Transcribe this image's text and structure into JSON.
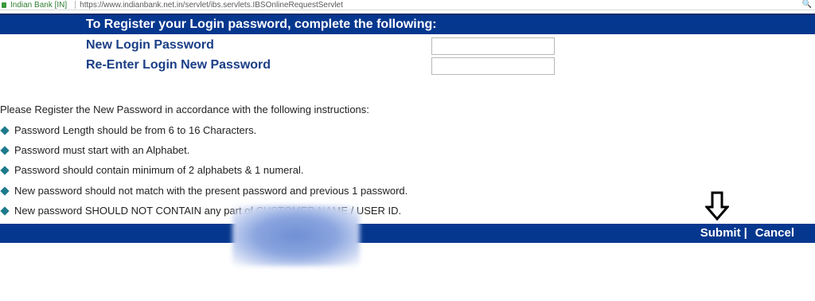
{
  "browser": {
    "site_name": "Indian Bank [IN]",
    "url": "https://www.indianbank.net.in/servlet/ibs.servlets.IBSOnlineRequestServlet",
    "zoom_icon": "zoom-icon"
  },
  "header": {
    "title": "To Register your Login password, complete the following:"
  },
  "form": {
    "new_password_label": "New Login Password",
    "reenter_password_label": "Re-Enter Login New Password",
    "new_password_value": "",
    "reenter_password_value": ""
  },
  "instructions": {
    "intro": "Please Register the New Password in accordance with the following instructions:",
    "items": [
      "Password Length should be from 6 to 16 Characters.",
      "Password must start with an Alphabet.",
      "Password should contain minimum of 2 alphabets & 1 numeral.",
      "New password should not match with the present password and previous 1 password.",
      "New password SHOULD NOT CONTAIN any part of CUSTOMER NAME / USER ID."
    ]
  },
  "footer": {
    "submit_label": "Submit",
    "divider": "|",
    "cancel_label": "Cancel"
  },
  "colors": {
    "bar_blue": "#06378f",
    "label_blue": "#1a3e86",
    "bullet_teal": "#1d7a8c"
  }
}
